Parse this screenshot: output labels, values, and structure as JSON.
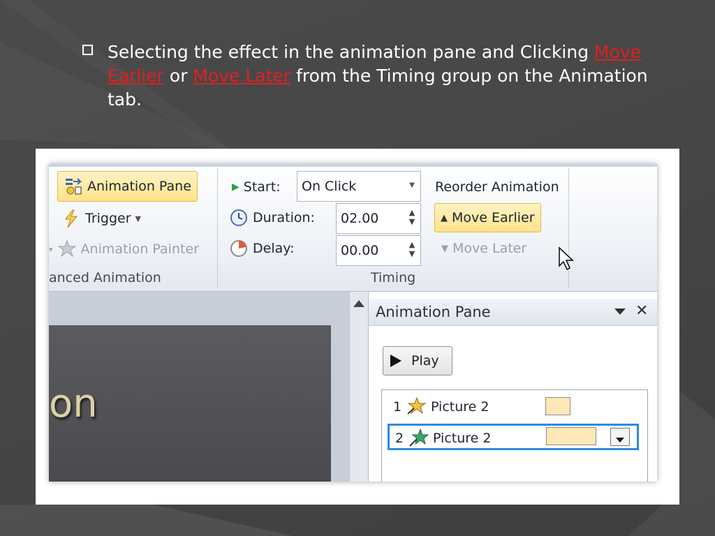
{
  "slide": {
    "bullet_part1": "Selecting the effect in the animation pane and Clicking ",
    "link_move_earlier": "Move Earlier",
    "bullet_or": " or ",
    "link_move_later": "Move Later",
    "bullet_part2": " from the Timing group on the Animation tab."
  },
  "ribbon": {
    "advanced_animation": {
      "animation_pane_label": "Animation Pane",
      "trigger_label": "Trigger",
      "animation_painter_label": "Animation Painter",
      "group_label": "anced Animation"
    },
    "timing": {
      "start_label": "Start:",
      "start_value": "On Click",
      "duration_label": "Duration:",
      "duration_value": "02.00",
      "delay_label": "Delay:",
      "delay_value": "00.00",
      "group_label": "Timing"
    },
    "reorder": {
      "heading": "Reorder Animation",
      "move_earlier_label": "Move Earlier",
      "move_later_label": "Move Later"
    }
  },
  "slide_thumb_text": "on",
  "animation_pane": {
    "title": "Animation Pane",
    "play_label": "Play",
    "items": [
      {
        "num": "1",
        "label": "Picture 2"
      },
      {
        "num": "2",
        "label": "Picture 2"
      }
    ]
  },
  "colors": {
    "link_red": "#e02020",
    "highlight_yellow": "#ffe28a",
    "selection_blue": "#2e8ae0",
    "timing_bar": "#fde8b6"
  }
}
